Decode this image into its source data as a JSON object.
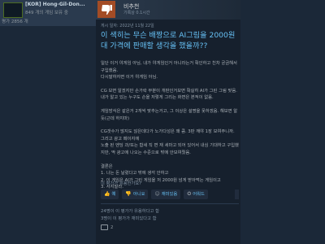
{
  "profile": {
    "username": "[KOR] Hong-Gil-Don...",
    "games_owned": "849 개의 게임 보유 중",
    "reviews": "평가 2856 개"
  },
  "review": {
    "verdict": "비추천",
    "hours": "기록상 0.1시간",
    "posted": "게시 일자: 2022년 11월 22일",
    "title": "이 색히는 무슨 배짱으로 AI그림을 2000원대 가격에 판매할 생각을 했을까??",
    "paragraphs": [
      "일단 이거 야게임 아님, 내가 야게임인거 아니라는거 확인하고 친차 궁금해서 구입했음.\n다시말하자면 이거 야게임 아님.",
      "CG 보면 알겠지만 손가락 부분이 개판인거보면 확실히 AI가 그린 그림 맞음. 내가 알고 있는 누구도 손을 저렇게 그리는 화면은 본적이 없음.",
      "게임방식은 같은거 2개씩 맞추는거고, 그 이상은 설명을 못하겠음. 해보면 알 듯(근데 하지마)",
      "CG갯수가 많지도 않은데다가 노가다성은 꽤 큼. 3판 깨야 1장 보여주니까. 그리고 광고 페이지에\n노출 된 엔딩 과/또는 합세 직 면 재 세마고 되어 있어서 내심 기대하고 구입했지만, 딱 광고에 나오는 수준으로 밖에 안보여줬음.",
      "결론은\n1. 나는 돈 날렸다고 밖에 생각 안하고\n2. 이 게임은 AI가 그린 게임을 저 2000원 넘게 받아먹는 게임이고\n3. 사지말라."
    ]
  },
  "votes": {
    "question": "이 평가가 유용한가요?",
    "yes": "예",
    "no": "아니요",
    "funny": "재미있음",
    "award": "어워드"
  },
  "stats": {
    "helpful": "24명이 이 평가가 유용하다고 함",
    "funny": "3명이 이 평가가 재미있다고 함",
    "comments": "2"
  }
}
